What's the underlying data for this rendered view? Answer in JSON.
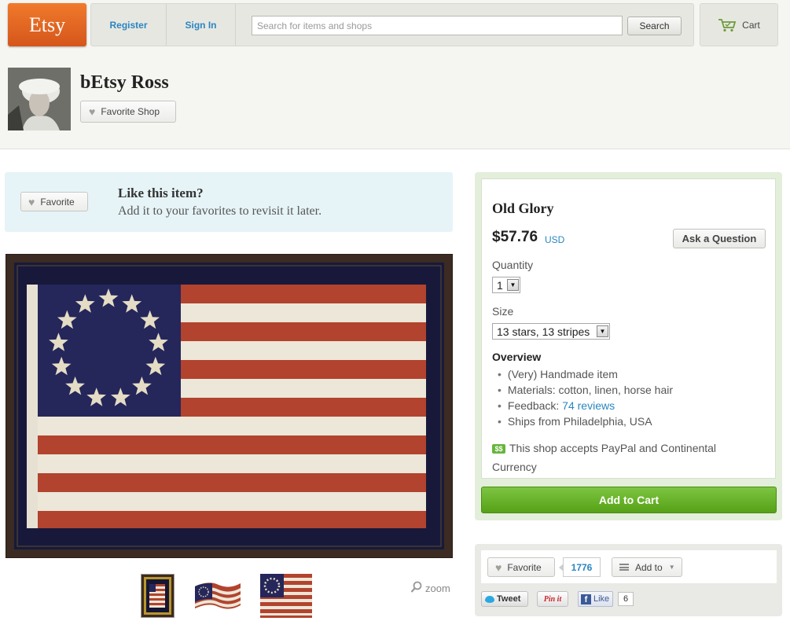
{
  "header": {
    "logo": "Etsy",
    "nav": {
      "register": "Register",
      "sign_in": "Sign In"
    },
    "search": {
      "placeholder": "Search for items and shops",
      "button": "Search"
    },
    "cart": "Cart"
  },
  "shop": {
    "name": "bEtsy Ross",
    "favorite_shop": "Favorite Shop"
  },
  "like_box": {
    "button": "Favorite",
    "title": "Like this item?",
    "subtitle": "Add it to your favorites to revisit it later."
  },
  "gallery": {
    "zoom": "zoom"
  },
  "product": {
    "title": "Old Glory",
    "price": "$57.76",
    "currency": "USD",
    "ask_question": "Ask a Question",
    "quantity_label": "Quantity",
    "quantity_value": "1",
    "size_label": "Size",
    "size_value": "13 stars, 13 stripes",
    "overview_title": "Overview",
    "overview": {
      "item1": "(Very) Handmade item",
      "item2": "Materials: cotton, linen, horse hair",
      "feedback_prefix": "Feedback: ",
      "feedback_link": "74 reviews",
      "item4": "Ships from Philadelphia, USA"
    },
    "payment_note": "This shop accepts PayPal and Continental Currency",
    "add_to_cart": "Add to Cart"
  },
  "social": {
    "favorite": "Favorite",
    "favorite_count": "1776",
    "add_to": "Add to",
    "tweet": "Tweet",
    "pinit": "Pin it",
    "like": "Like",
    "like_count": "6"
  },
  "colors": {
    "etsy_orange": "#e86a24",
    "link_blue": "#2a86c0",
    "add_to_cart_green": "#6bb52d",
    "flag_red": "#b2432e",
    "flag_blue": "#25265a"
  }
}
